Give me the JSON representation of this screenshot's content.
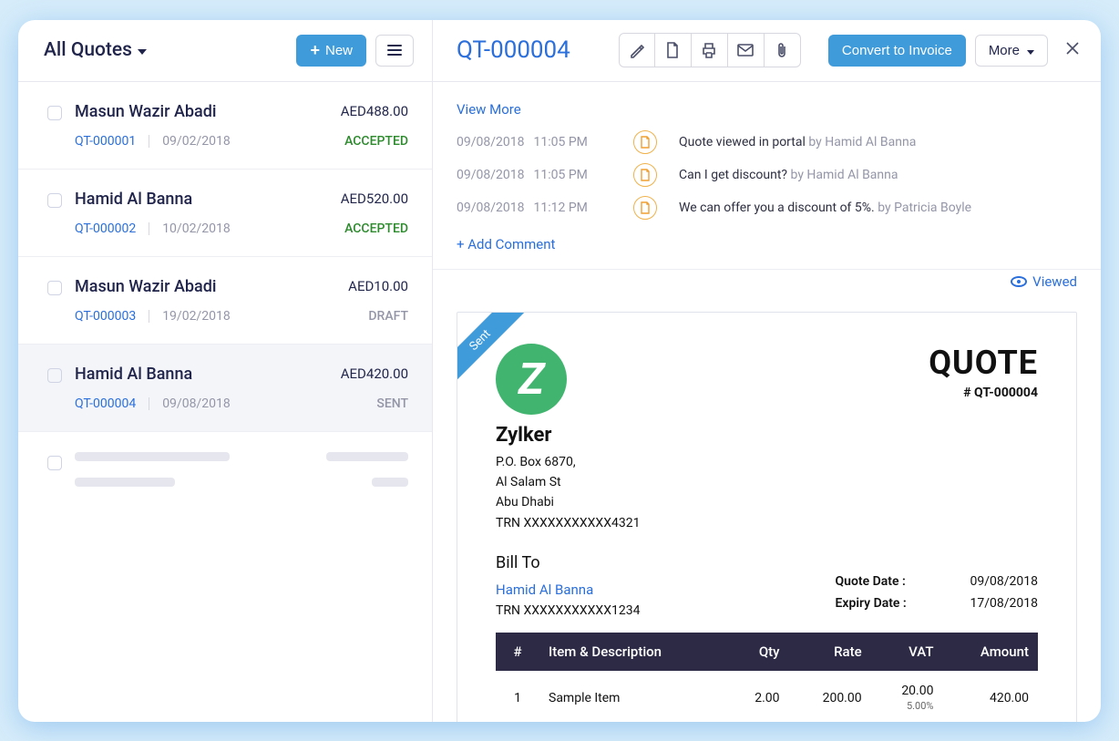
{
  "left": {
    "title": "All Quotes",
    "new_label": "New",
    "quotes": [
      {
        "name": "Masun Wazir Abadi",
        "id": "QT-000001",
        "date": "09/02/2018",
        "amount": "AED488.00",
        "status": "ACCEPTED",
        "status_class": "st-accepted"
      },
      {
        "name": "Hamid Al Banna",
        "id": "QT-000002",
        "date": "10/02/2018",
        "amount": "AED520.00",
        "status": "ACCEPTED",
        "status_class": "st-accepted"
      },
      {
        "name": "Masun Wazir Abadi",
        "id": "QT-000003",
        "date": "19/02/2018",
        "amount": "AED10.00",
        "status": "DRAFT",
        "status_class": "st-draft"
      },
      {
        "name": "Hamid Al Banna",
        "id": "QT-000004",
        "date": "09/08/2018",
        "amount": "AED420.00",
        "status": "SENT",
        "status_class": "st-sent"
      }
    ]
  },
  "right": {
    "title": "QT-000004",
    "convert_label": "Convert to Invoice",
    "more_label": "More",
    "view_more": "View More",
    "add_comment": "+  Add Comment",
    "viewed_label": "Viewed",
    "activity": [
      {
        "date": "09/08/2018",
        "time": "11:05 PM",
        "text": "Quote viewed in portal",
        "by": "by Hamid Al Banna"
      },
      {
        "date": "09/08/2018",
        "time": "11:05 PM",
        "text": "Can I get discount?",
        "by": "by Hamid Al Banna"
      },
      {
        "date": "09/08/2018",
        "time": "11:12 PM",
        "text": "We can offer you a discount of 5%.",
        "by": "by Patricia Boyle"
      }
    ]
  },
  "document": {
    "ribbon": "Sent",
    "title": "QUOTE",
    "number": "# QT-000004",
    "company": {
      "logo_letter": "Z",
      "name": "Zylker",
      "addr1": "P.O. Box 6870,",
      "addr2": "Al Salam St",
      "addr3": "Abu Dhabi",
      "trn": "TRN XXXXXXXXXXX4321"
    },
    "bill_to": {
      "label": "Bill To",
      "name": "Hamid Al Banna",
      "trn": "TRN XXXXXXXXXXX1234"
    },
    "dates": {
      "quote_label": "Quote Date :",
      "quote_value": "09/08/2018",
      "expiry_label": "Expiry Date :",
      "expiry_value": "17/08/2018"
    },
    "headers": {
      "num": "#",
      "item": "Item & Description",
      "qty": "Qty",
      "rate": "Rate",
      "vat": "VAT",
      "amount": "Amount"
    },
    "rows": [
      {
        "num": "1",
        "item": "Sample Item",
        "qty": "2.00",
        "rate": "200.00",
        "vat": "20.00",
        "vat_pct": "5.00%",
        "amount": "420.00"
      }
    ]
  }
}
